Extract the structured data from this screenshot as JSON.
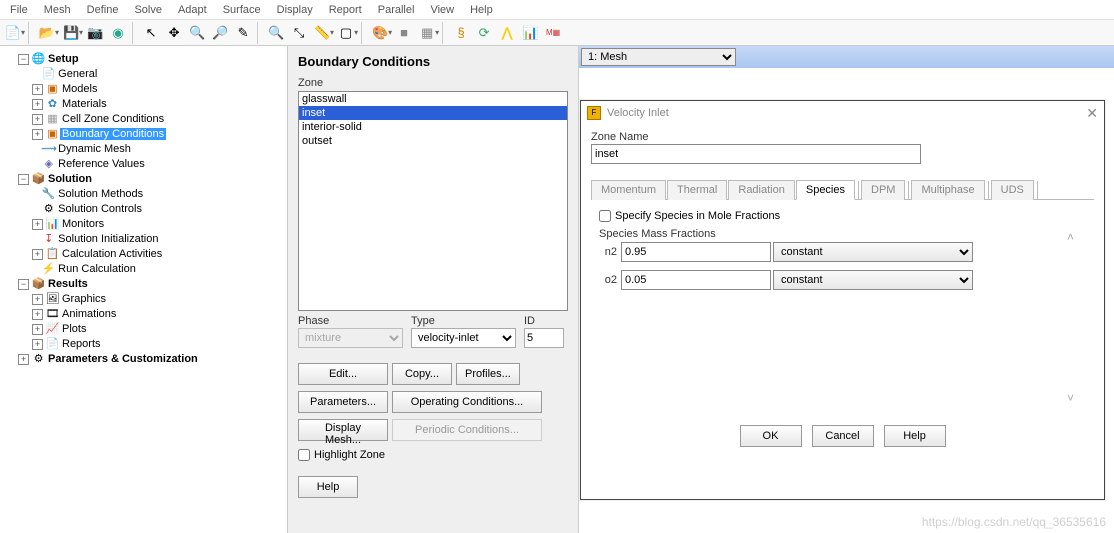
{
  "menu": [
    "File",
    "Mesh",
    "Define",
    "Solve",
    "Adapt",
    "Surface",
    "Display",
    "Report",
    "Parallel",
    "View",
    "Help"
  ],
  "tree": {
    "setup": "Setup",
    "general": "General",
    "models": "Models",
    "materials": "Materials",
    "cellzone": "Cell Zone Conditions",
    "boundary": "Boundary Conditions",
    "dynmesh": "Dynamic Mesh",
    "refvals": "Reference Values",
    "solution": "Solution",
    "solmethods": "Solution Methods",
    "solctrls": "Solution Controls",
    "monitors": "Monitors",
    "solinit": "Solution Initialization",
    "calcact": "Calculation Activities",
    "runcalc": "Run Calculation",
    "results": "Results",
    "graphics": "Graphics",
    "animations": "Animations",
    "plots": "Plots",
    "reports": "Reports",
    "params": "Parameters & Customization"
  },
  "bc": {
    "title": "Boundary Conditions",
    "zone_label": "Zone",
    "zones": [
      "glasswall",
      "inset",
      "interior-solid",
      "outset"
    ],
    "selected": "inset",
    "phase_label": "Phase",
    "phase_val": "mixture",
    "type_label": "Type",
    "type_val": "velocity-inlet",
    "id_label": "ID",
    "id_val": "5",
    "btn_edit": "Edit...",
    "btn_copy": "Copy...",
    "btn_profiles": "Profiles...",
    "btn_params": "Parameters...",
    "btn_opcond": "Operating Conditions...",
    "btn_dispmesh": "Display Mesh...",
    "btn_periodic": "Periodic Conditions...",
    "chk_highlight": "Highlight Zone",
    "btn_help": "Help"
  },
  "meshbar": {
    "selected": "1: Mesh"
  },
  "dlg": {
    "title": "Velocity Inlet",
    "zone_label": "Zone Name",
    "zone_val": "inset",
    "tabs": [
      "Momentum",
      "Thermal",
      "Radiation",
      "Species",
      "DPM",
      "Multiphase",
      "UDS"
    ],
    "active_tab": "Species",
    "chk_mole": "Specify Species in Mole Fractions",
    "sec_title": "Species Mass Fractions",
    "rows": [
      {
        "sp": "n2",
        "val": "0.95",
        "mode": "constant"
      },
      {
        "sp": "o2",
        "val": "0.05",
        "mode": "constant"
      }
    ],
    "btn_ok": "OK",
    "btn_cancel": "Cancel",
    "btn_help": "Help"
  },
  "watermark": "https://blog.csdn.net/qq_36535616"
}
